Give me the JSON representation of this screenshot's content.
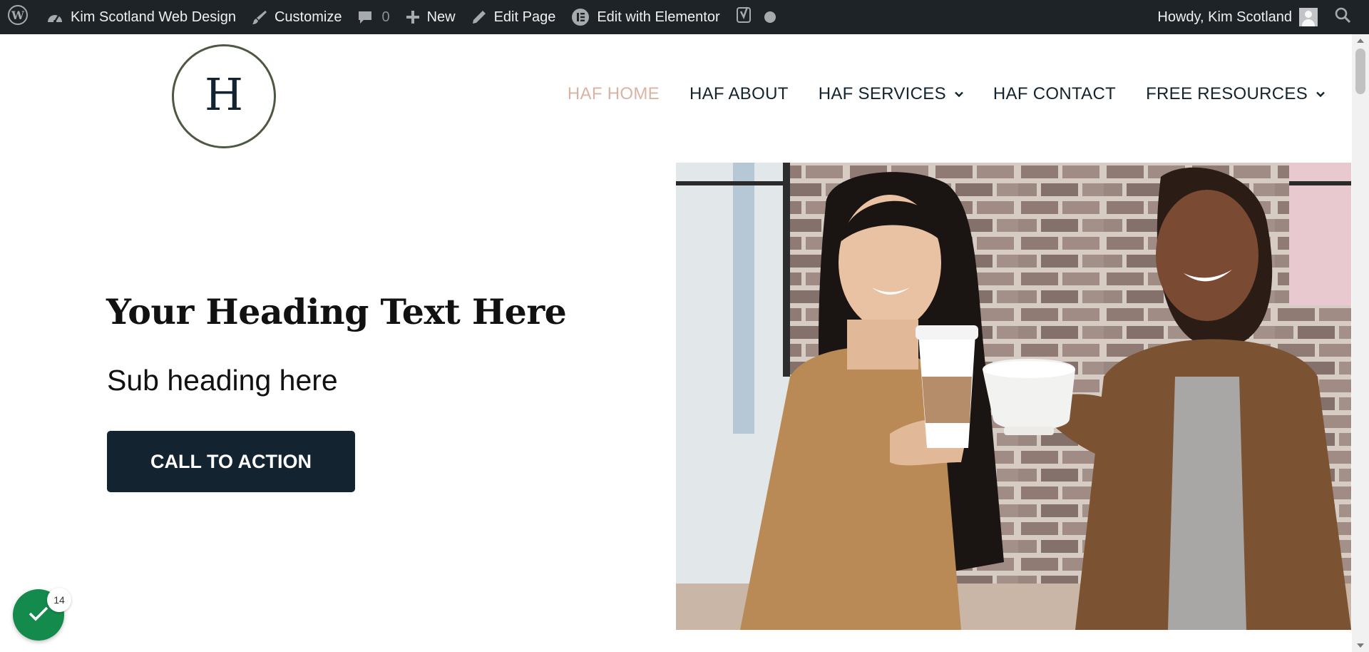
{
  "admin_bar": {
    "site_name": "Kim Scotland Web Design",
    "customize": "Customize",
    "comments_count": "0",
    "new": "New",
    "edit_page": "Edit Page",
    "edit_elementor": "Edit with Elementor",
    "howdy": "Howdy, Kim Scotland"
  },
  "logo": {
    "letter": "H"
  },
  "nav": {
    "items": [
      {
        "label": "HAF HOME",
        "active": true
      },
      {
        "label": "HAF ABOUT"
      },
      {
        "label": "HAF SERVICES",
        "has_dropdown": true
      },
      {
        "label": "HAF CONTACT"
      },
      {
        "label": "FREE RESOURCES",
        "has_dropdown": true
      }
    ]
  },
  "hero": {
    "heading": "Your Heading Text Here",
    "subheading": "Sub heading here",
    "cta": "CALL TO ACTION"
  },
  "badge": {
    "count": "14"
  },
  "colors": {
    "admin_bar_bg": "#1d2327",
    "nav_active": "#d9b4a3",
    "navy": "#13232f",
    "logo_ring": "#4d5842",
    "badge_green": "#148a4c"
  }
}
